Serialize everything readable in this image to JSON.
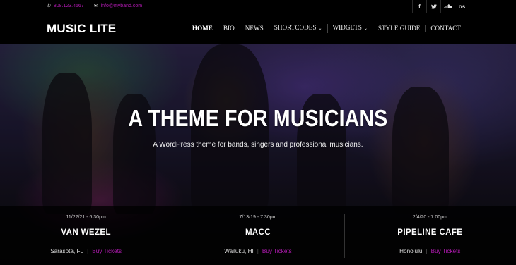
{
  "topbar": {
    "phone": "808.123.4567",
    "email": "info@myband.com",
    "social": [
      {
        "icon": "facebook-icon",
        "glyph": "f"
      },
      {
        "icon": "twitter-icon",
        "glyph": "🐦"
      },
      {
        "icon": "soundcloud-icon",
        "glyph": "☁"
      },
      {
        "icon": "lastfm-icon",
        "glyph": "os"
      }
    ]
  },
  "header": {
    "logo": "MUSIC LITE",
    "nav": [
      {
        "label": "HOME",
        "dropdown": false
      },
      {
        "label": "BIO",
        "dropdown": false
      },
      {
        "label": "NEWS",
        "dropdown": false
      },
      {
        "label": "SHORTCODES",
        "dropdown": true
      },
      {
        "label": "WIDGETS",
        "dropdown": true
      },
      {
        "label": "STYLE GUIDE",
        "dropdown": false
      },
      {
        "label": "CONTACT",
        "dropdown": false
      }
    ]
  },
  "hero": {
    "title": "A THEME FOR MUSICIANS",
    "subtitle": "A WordPress theme for bands, singers and professional musicians."
  },
  "events": [
    {
      "date": "11/22/21 - 6:30pm",
      "title": "VAN WEZEL",
      "location": "Sarasota, FL",
      "link": "Buy Tickets"
    },
    {
      "date": "7/13/19 - 7:30pm",
      "title": "MACC",
      "location": "Wailuku, HI",
      "link": "Buy Tickets"
    },
    {
      "date": "2/4/20 - 7:00pm",
      "title": "PIPELINE CAFE",
      "location": "Honolulu",
      "link": "Buy Tickets"
    }
  ],
  "colors": {
    "accent": "#b51bb5",
    "background": "#000000"
  }
}
